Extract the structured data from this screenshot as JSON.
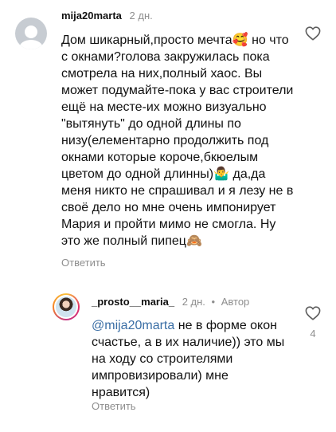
{
  "comments": [
    {
      "username": "mija20marta",
      "timestamp": "2 дн.",
      "text": "Дом шикарный,просто мечта🥰 но что с окнами?голова закружилась пока смотрела на них,полный хаос. Вы может подумайте-пока у вас строители ещё на месте-их можно визуально \"вытянуть\" до одной длины по низу(елементарно продолжить под окнами которые короче,бкюелым цветом до одной длинны)🤷‍♂️ да,да меня никто не спрашивал и я лезу не в своё дело но мне очень импонирует Мария и пройти мимо не смогла. Ну это же полный пипец🙈",
      "reply_label": "Ответить",
      "like_icon": "heart-outline-icon"
    },
    {
      "username": "_prosto__maria_",
      "timestamp": "2 дн.",
      "separator": "•",
      "author_tag": "Автор",
      "mention": "@mija20marta",
      "text": " не в форме окон счастье, а в их наличие)) это мы на ходу со строителями импровизировали) мне нравится)",
      "reply_label": "Ответить",
      "like_icon": "heart-outline-icon",
      "like_count": "4"
    }
  ],
  "colors": {
    "text": "#111111",
    "muted": "#8e8e8e",
    "mention": "#3a6ea5",
    "background": "#ffffff"
  }
}
